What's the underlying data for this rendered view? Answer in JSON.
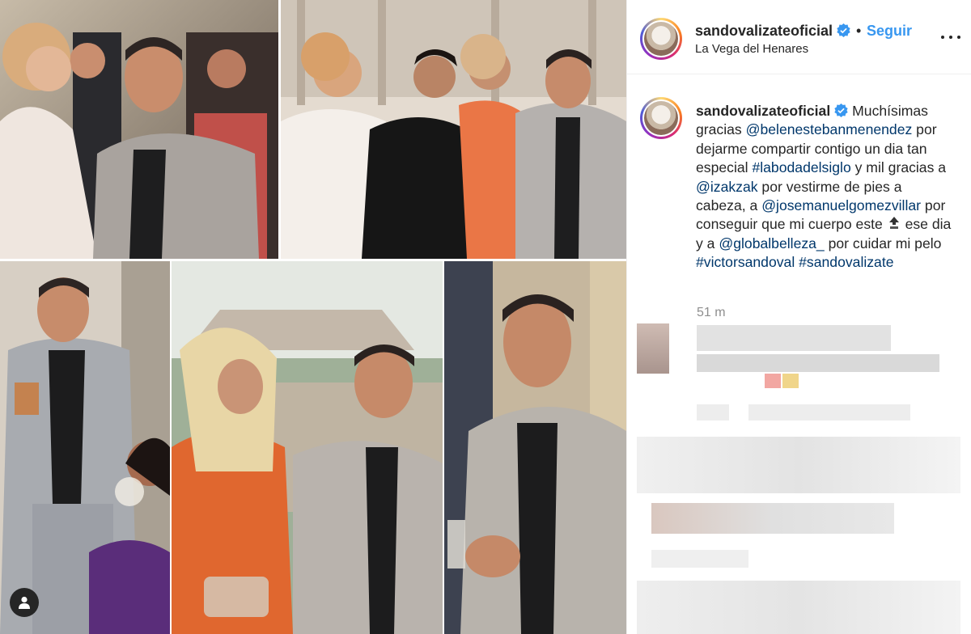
{
  "post": {
    "username": "sandovalizateoficial",
    "separator": "•",
    "follow_label": "Seguir",
    "location": "La Vega del Henares",
    "caption": {
      "t1": " Muchísimas gracias ",
      "m1": "@belenestebanmenendez",
      "t2": " por dejarme compartir contigo un dia tan especial ",
      "h1": "#labodadelsiglo",
      "t3": " y mil gracias a ",
      "m2": "@izakzak",
      "t4": " por vestirme de pies a cabeza, a ",
      "m3": "@josemanuelgomezvillar",
      "t5": " por conseguir que mi cuerpo este ",
      "t6": " ese dia y a ",
      "m4": "@globalbelleza_",
      "t7": " por cuidar mi pelo ",
      "h2": "#victorsandoval",
      "h3": "#sandovalizate"
    },
    "time_ago": "51 m"
  },
  "icons": {
    "verified": "verified-badge-icon",
    "more": "more-options-icon",
    "user_tag": "user-tag-icon",
    "top_emoji": "top-arrow-emoji-icon"
  },
  "colors": {
    "accent": "#3897f0",
    "link": "#00376b",
    "muted": "#8e8e8e"
  }
}
